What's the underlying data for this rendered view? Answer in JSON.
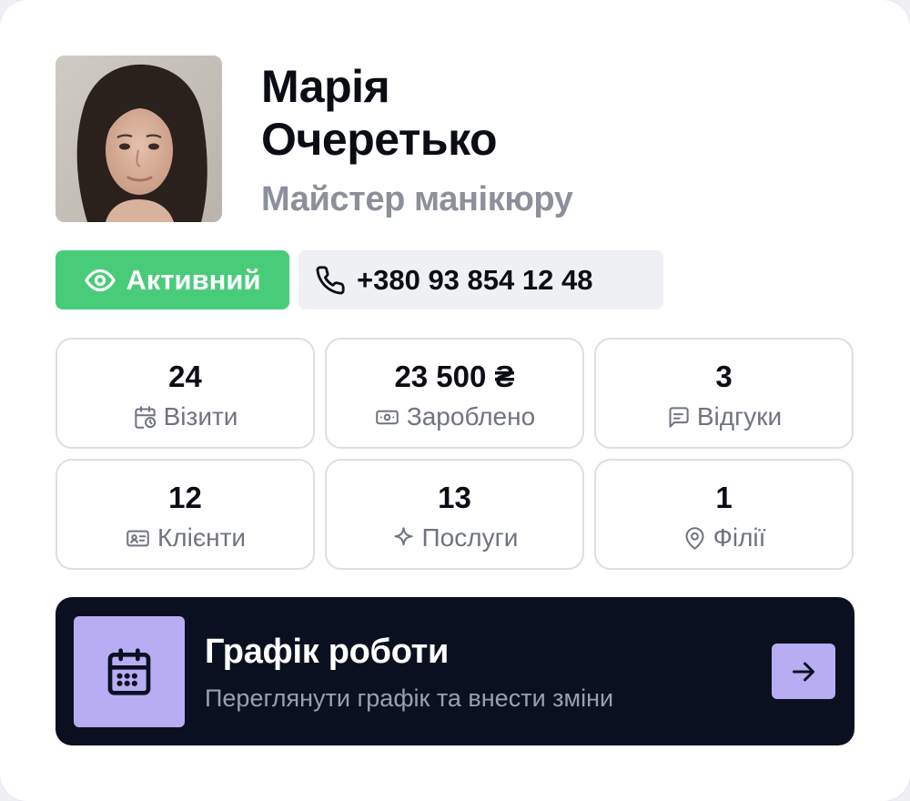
{
  "profile": {
    "name_line1": "Марія",
    "name_line2": "Очеретько",
    "role": "Майстер манікюру",
    "status": "Активний",
    "phone": "+380 93 854 12 48"
  },
  "stats": [
    {
      "value": "24",
      "label": "Візити",
      "icon": "calendar-clock-icon"
    },
    {
      "value": "23 500 ₴",
      "label": "Зароблено",
      "icon": "banknote-icon"
    },
    {
      "value": "3",
      "label": "Відгуки",
      "icon": "message-icon"
    },
    {
      "value": "12",
      "label": "Клієнти",
      "icon": "id-card-icon"
    },
    {
      "value": "13",
      "label": "Послуги",
      "icon": "sparkle-icon"
    },
    {
      "value": "1",
      "label": "Філії",
      "icon": "map-pin-icon"
    }
  ],
  "schedule": {
    "title": "Графік роботи",
    "subtitle": "Переглянути графік та внести зміни",
    "icon": "calendar-icon",
    "action_icon": "arrow-right-icon"
  },
  "colors": {
    "status_green": "#49cc7a",
    "accent_lavender": "#b8acf2",
    "dark_panel": "#0a1020",
    "muted_text": "#8b909a"
  }
}
